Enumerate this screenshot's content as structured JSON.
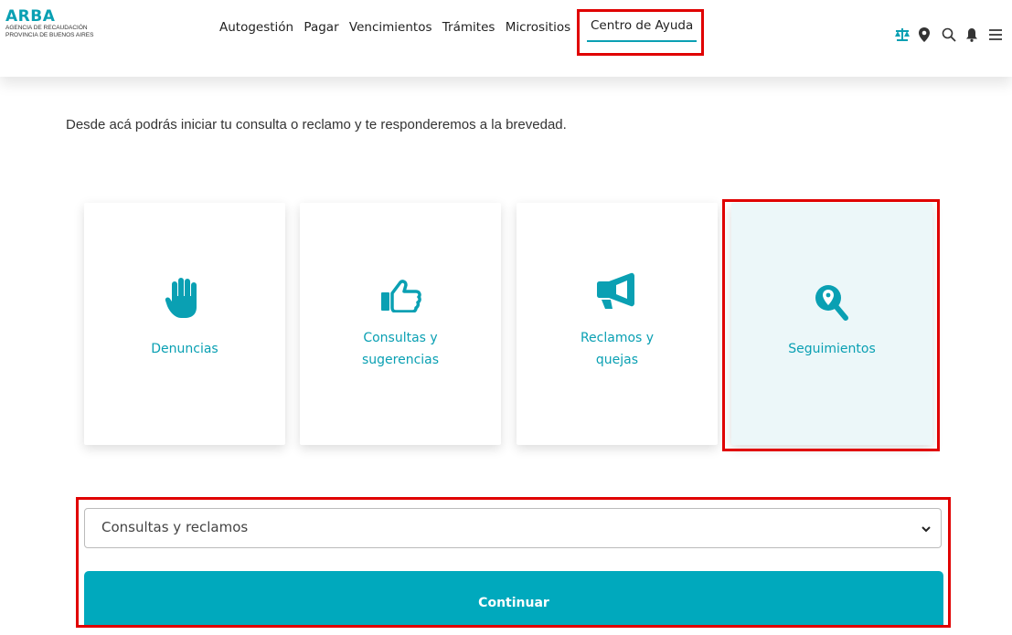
{
  "logo": {
    "title": "ARBA",
    "line1": "AGENCIA DE RECAUDACIÓN",
    "line2": "PROVINCIA DE BUENOS AIRES"
  },
  "nav": {
    "items": [
      "Autogestión",
      "Pagar",
      "Vencimientos",
      "Trámites",
      "Micrositios"
    ],
    "active": "Centro de Ayuda"
  },
  "header_icons": [
    "balance-scale-icon",
    "map-pin-icon",
    "search-icon",
    "bell-icon",
    "menu-icon"
  ],
  "intro": "Desde acá podrás iniciar tu consulta o reclamo y te responderemos a la brevedad.",
  "cards": [
    {
      "line1": "Denuncias",
      "line2": "",
      "icon": "hand-icon"
    },
    {
      "line1": "Consultas y",
      "line2": "sugerencias",
      "icon": "thumbs-up-icon"
    },
    {
      "line1": "Reclamos y",
      "line2": "quejas",
      "icon": "megaphone-icon"
    },
    {
      "line1": "Seguimientos",
      "line2": "",
      "icon": "search-location-icon"
    }
  ],
  "select": {
    "value": "Consultas y reclamos"
  },
  "button": {
    "label": "Continuar"
  },
  "colors": {
    "accent": "#0aa0b3",
    "button": "#00a9bd",
    "highlight": "#e00000",
    "active_card": "#ecf7f9"
  }
}
